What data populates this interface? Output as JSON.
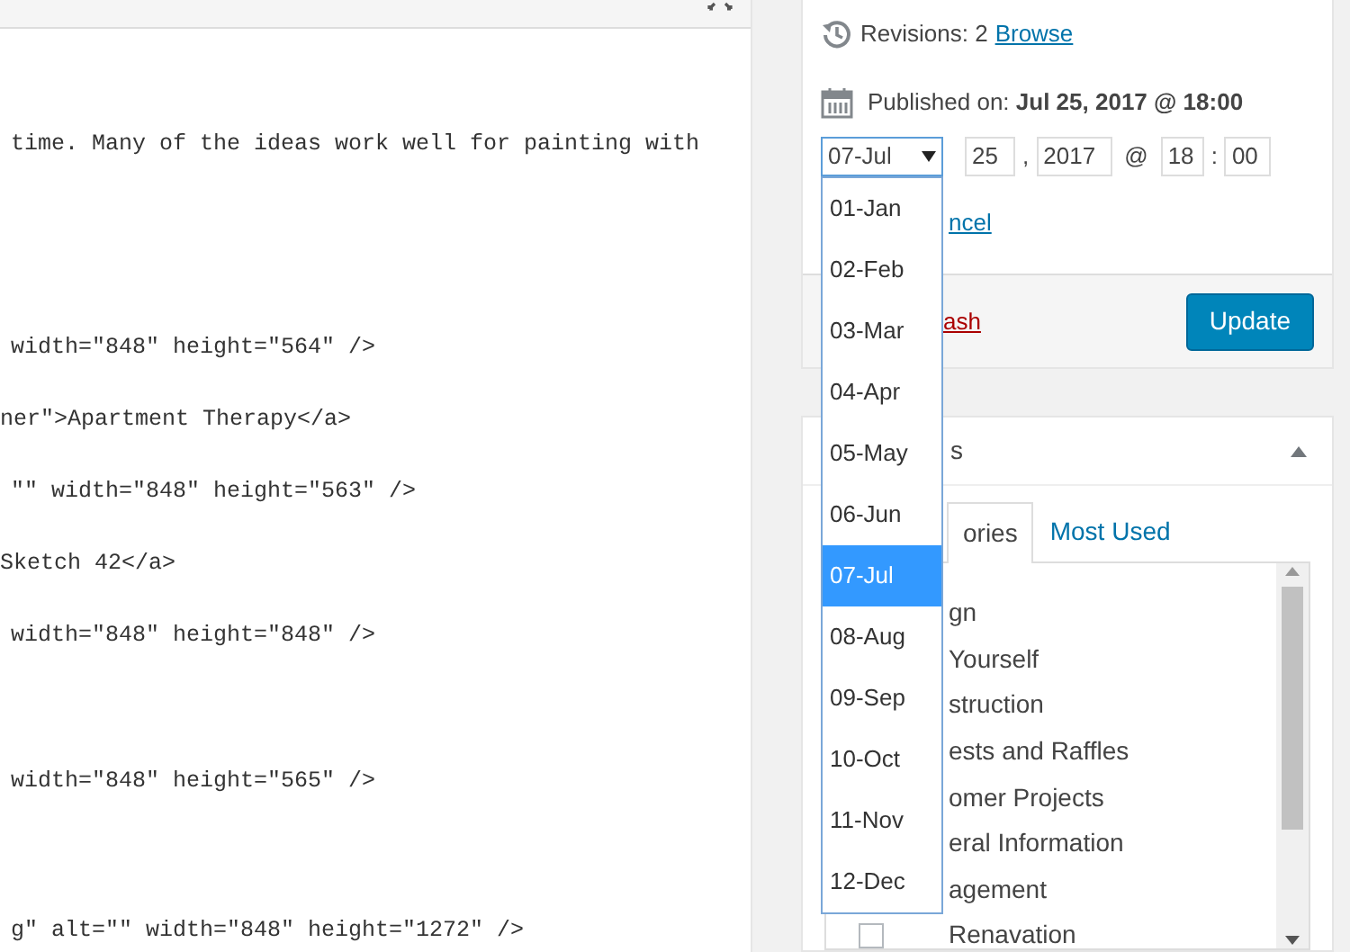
{
  "editor": {
    "lines": [
      "time. Many of the ideas work well for painting with",
      "width=\"848\" height=\"564\" />",
      "ner\">Apartment Therapy</a>",
      "\"\" width=\"848\" height=\"563\" />",
      "Sketch 42</a>",
      "width=\"848\" height=\"848\" />",
      "width=\"848\" height=\"565\" />",
      "g\" alt=\"\" width=\"848\" height=\"1272\" />"
    ]
  },
  "publish": {
    "revisions_label": "Revisions: 2",
    "browse_link": "Browse",
    "published_label": "Published on:",
    "published_value": "Jul 25, 2017 @ 18:00",
    "date": {
      "month": "07-Jul",
      "day": "25",
      "comma": ",",
      "year": "2017",
      "at": "@",
      "hour": "18",
      "colon": ":",
      "minute": "00"
    },
    "month_options": [
      {
        "label": "01-Jan",
        "selected": false
      },
      {
        "label": "02-Feb",
        "selected": false
      },
      {
        "label": "03-Mar",
        "selected": false
      },
      {
        "label": "04-Apr",
        "selected": false
      },
      {
        "label": "05-May",
        "selected": false
      },
      {
        "label": "06-Jun",
        "selected": false
      },
      {
        "label": "07-Jul",
        "selected": true
      },
      {
        "label": "08-Aug",
        "selected": false
      },
      {
        "label": "09-Sep",
        "selected": false
      },
      {
        "label": "10-Oct",
        "selected": false
      },
      {
        "label": "11-Nov",
        "selected": false
      },
      {
        "label": "12-Dec",
        "selected": false
      }
    ],
    "cancel_link": "ncel",
    "trash_link": "ash",
    "update_button": "Update"
  },
  "categories": {
    "title": "s",
    "expanded": true,
    "tabs": [
      {
        "label": "ories",
        "selected": true
      },
      {
        "label": "Most Used",
        "selected": false
      }
    ],
    "items": [
      {
        "label": "gn"
      },
      {
        "label": "Yourself"
      },
      {
        "label": "struction"
      },
      {
        "label": "ests and Raffles"
      },
      {
        "label": "omer Projects"
      },
      {
        "label": "eral Information"
      },
      {
        "label": "agement"
      },
      {
        "label": "Renavation",
        "checked": false
      }
    ]
  }
}
